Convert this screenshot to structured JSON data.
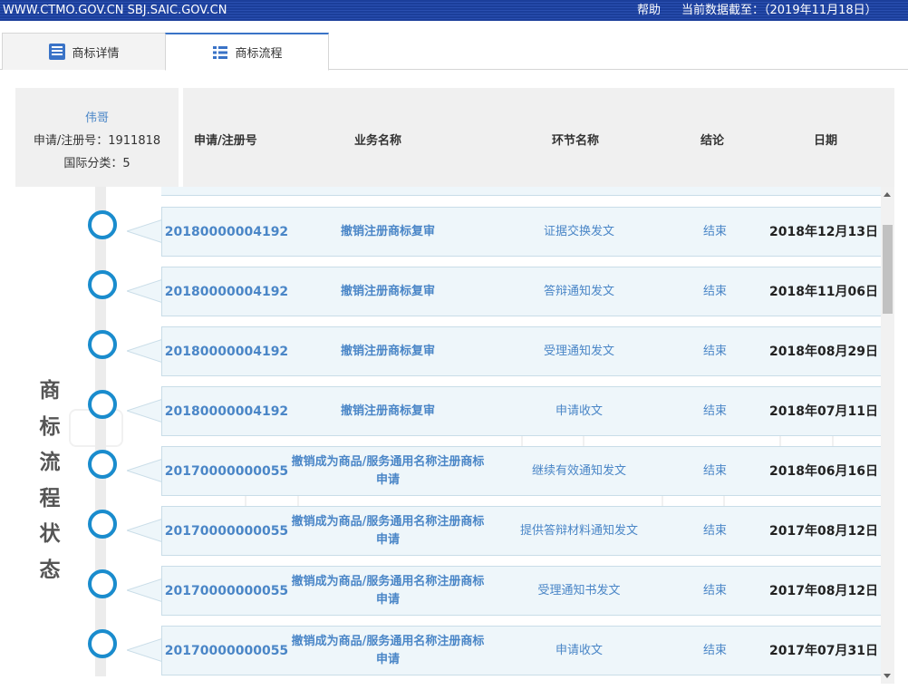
{
  "topbar": {
    "site": "WWW.CTMO.GOV.CN SBJ.SAIC.GOV.CN",
    "help": "帮助",
    "as_of": "当前数据截至：（2019年11月18日）"
  },
  "tabs": [
    {
      "label": "商标详情",
      "icon": "document-icon"
    },
    {
      "label": "商标流程",
      "icon": "list-icon"
    }
  ],
  "info": {
    "name": "伟哥",
    "reg_no": "申请/注册号：1911818",
    "class": "国际分类：5"
  },
  "header": {
    "col_no": "申请/注册号",
    "col_biz": "业务名称",
    "col_step": "环节名称",
    "col_result": "结论",
    "col_date": "日期"
  },
  "vertical_title": [
    "商",
    "标",
    "流",
    "程",
    "状",
    "态"
  ],
  "rows": [
    {
      "no": "20180000004192",
      "biz": "撤销注册商标复审",
      "step": "证据交换发文",
      "result": "结束",
      "date": "2018年12月13日"
    },
    {
      "no": "20180000004192",
      "biz": "撤销注册商标复审",
      "step": "答辩通知发文",
      "result": "结束",
      "date": "2018年11月06日"
    },
    {
      "no": "20180000004192",
      "biz": "撤销注册商标复审",
      "step": "受理通知发文",
      "result": "结束",
      "date": "2018年08月29日"
    },
    {
      "no": "20180000004192",
      "biz": "撤销注册商标复审",
      "step": "申请收文",
      "result": "结束",
      "date": "2018年07月11日"
    },
    {
      "no": "20170000000055",
      "biz": "撤销成为商品/服务通用名称注册商标申请",
      "step": "继续有效通知发文",
      "result": "结束",
      "date": "2018年06月16日"
    },
    {
      "no": "20170000000055",
      "biz": "撤销成为商品/服务通用名称注册商标申请",
      "step": "提供答辩材料通知发文",
      "result": "结束",
      "date": "2017年08月12日"
    },
    {
      "no": "20170000000055",
      "biz": "撤销成为商品/服务通用名称注册商标申请",
      "step": "受理通知书发文",
      "result": "结束",
      "date": "2017年08月12日"
    },
    {
      "no": "20170000000055",
      "biz": "撤销成为商品/服务通用名称注册商标申请",
      "step": "申请收文",
      "result": "结束",
      "date": "2017年07月31日"
    }
  ]
}
